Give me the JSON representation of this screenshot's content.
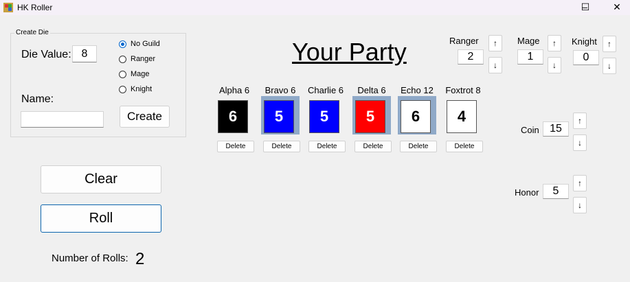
{
  "window": {
    "title": "HK Roller",
    "minimize": "–",
    "maximize": "☐",
    "close": "✕"
  },
  "create_die": {
    "group_title": "Create Die",
    "die_value_label": "Die Value:",
    "die_value": "8",
    "name_label": "Name:",
    "name_value": "",
    "guild_options": [
      {
        "label": "No Guild",
        "checked": true
      },
      {
        "label": "Ranger",
        "checked": false
      },
      {
        "label": "Mage",
        "checked": false
      },
      {
        "label": "Knight",
        "checked": false
      }
    ],
    "create_label": "Create"
  },
  "actions": {
    "clear_label": "Clear",
    "roll_label": "Roll"
  },
  "rolls": {
    "label": "Number of Rolls:",
    "count": "2"
  },
  "party": {
    "title": "Your Party",
    "delete_label": "Delete",
    "dice": [
      {
        "name": "Alpha 6",
        "value": "6",
        "color": "#000000",
        "text_color": "#ffffff",
        "highlighted": false
      },
      {
        "name": "Bravo 6",
        "value": "5",
        "color": "#0000ff",
        "text_color": "#ffffff",
        "highlighted": true
      },
      {
        "name": "Charlie 6",
        "value": "5",
        "color": "#0000ff",
        "text_color": "#ffffff",
        "highlighted": false
      },
      {
        "name": "Delta 6",
        "value": "5",
        "color": "#ff0000",
        "text_color": "#ffffff",
        "highlighted": true
      },
      {
        "name": "Echo 12",
        "value": "6",
        "color": "#ffffff",
        "text_color": "#000000",
        "highlighted": true
      },
      {
        "name": "Foxtrot 8",
        "value": "4",
        "color": "#ffffff",
        "text_color": "#000000",
        "highlighted": false
      }
    ]
  },
  "counters": {
    "ranger": {
      "label": "Ranger",
      "value": "2"
    },
    "mage": {
      "label": "Mage",
      "value": "1"
    },
    "knight": {
      "label": "Knight",
      "value": "0"
    },
    "coin": {
      "label": "Coin",
      "value": "15"
    },
    "honor": {
      "label": "Honor",
      "value": "5"
    },
    "up": "↑",
    "down": "↓"
  }
}
